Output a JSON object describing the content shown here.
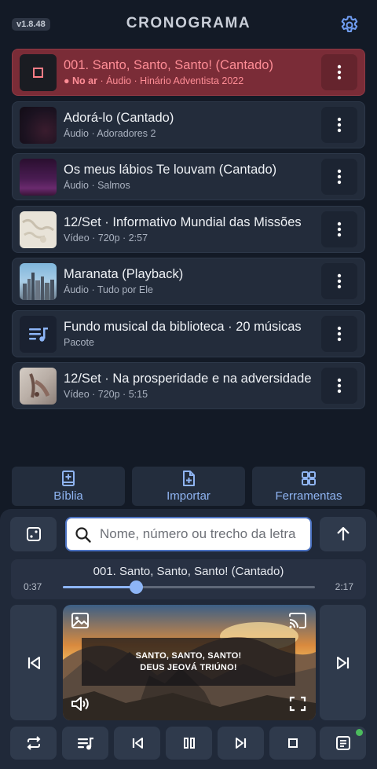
{
  "header": {
    "version": "v1.8.48",
    "title": "CRONOGRAMA",
    "settings_icon": "gear-icon"
  },
  "queue": [
    {
      "title": "001. Santo, Santo, Santo! (Cantado)",
      "live": "● No ar",
      "meta": " · Áudio · Hinário Adventista 2022",
      "active": true,
      "thumb": "stop-square"
    },
    {
      "title": "Adorá-lo (Cantado)",
      "meta": "Áudio · Adoradores 2",
      "thumb": "dark-gradient"
    },
    {
      "title": "Os meus lábios Te louvam (Cantado)",
      "meta": "Áudio · Salmos",
      "thumb": "purple-gradient"
    },
    {
      "title": "12/Set · Informativo Mundial das Missões",
      "meta": "Vídeo · 720p · 2:57",
      "thumb": "map-image"
    },
    {
      "title": "Maranata (Playback)",
      "meta": "Áudio · Tudo por Ele",
      "thumb": "city-image"
    },
    {
      "title": "Fundo musical da biblioteca · 20 músicas",
      "meta": "Pacote",
      "thumb": "playlist-icon"
    },
    {
      "title": "12/Set · Na prosperidade e na adversidade",
      "meta": "Vídeo · 720p · 5:15",
      "thumb": "hands-image"
    }
  ],
  "tools": {
    "bible": "Bíblia",
    "import": "Importar",
    "tools": "Ferramentas"
  },
  "search": {
    "placeholder": "Nome, número ou trecho da letra"
  },
  "now_playing": {
    "title": "001. Santo, Santo, Santo! (Cantado)",
    "current_time": "0:37",
    "total_time": "2:17",
    "progress": 0.29
  },
  "preview": {
    "line1": "SANTO, SANTO, SANTO!",
    "line2": "DEUS JEOVÁ TRIÚNO!"
  },
  "colors": {
    "background": "#131a26",
    "active_item": "#7a2c37",
    "accent": "#8db5f6",
    "live_text": "#ff8d96",
    "status_dot": "#4cbb5d"
  }
}
